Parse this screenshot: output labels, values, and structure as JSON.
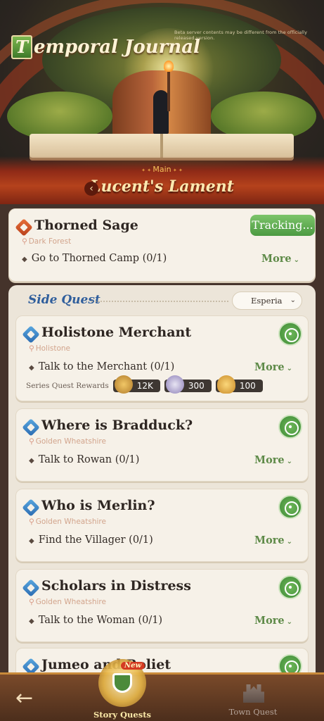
{
  "header": {
    "title_cap": "T",
    "title_rest": "emporal Journal",
    "server_note": "Beta server contents may be different from the officially released version."
  },
  "chapter": {
    "tag": "Main",
    "name": "Lucent's Lament"
  },
  "main_quest": {
    "title": "Thorned Sage",
    "location": "Dark Forest",
    "objective": "Go to Thorned Camp (0/1)",
    "track_label": "Tracking...",
    "more_label": "More"
  },
  "side_section": {
    "header": "Side Quest",
    "region": "Esperia"
  },
  "side_quests": [
    {
      "title": "Holistone Merchant",
      "location": "Holistone",
      "objective": "Talk to the Merchant (0/1)",
      "more_label": "More",
      "rewards_label": "Series Quest Rewards",
      "rewards": [
        "12K",
        "300",
        "100"
      ]
    },
    {
      "title": "Where is Bradduck?",
      "location": "Golden Wheatshire",
      "objective": "Talk to Rowan (0/1)",
      "more_label": "More"
    },
    {
      "title": "Who is Merlin?",
      "location": "Golden Wheatshire",
      "objective": "Find the Villager (0/1)",
      "more_label": "More"
    },
    {
      "title": "Scholars in Distress",
      "location": "Golden Wheatshire",
      "objective": "Talk to the Woman (0/1)",
      "more_label": "More"
    },
    {
      "title": "Jumeo and Roliet"
    }
  ],
  "bottom_nav": {
    "back_icon": "←",
    "story_label": "Story Quests",
    "story_badge": "New",
    "town_label": "Town Quest"
  },
  "colors": {
    "accent_green": "#5e8a48",
    "side_header_blue": "#2f5e9c",
    "chapter_red": "#b5421c"
  }
}
